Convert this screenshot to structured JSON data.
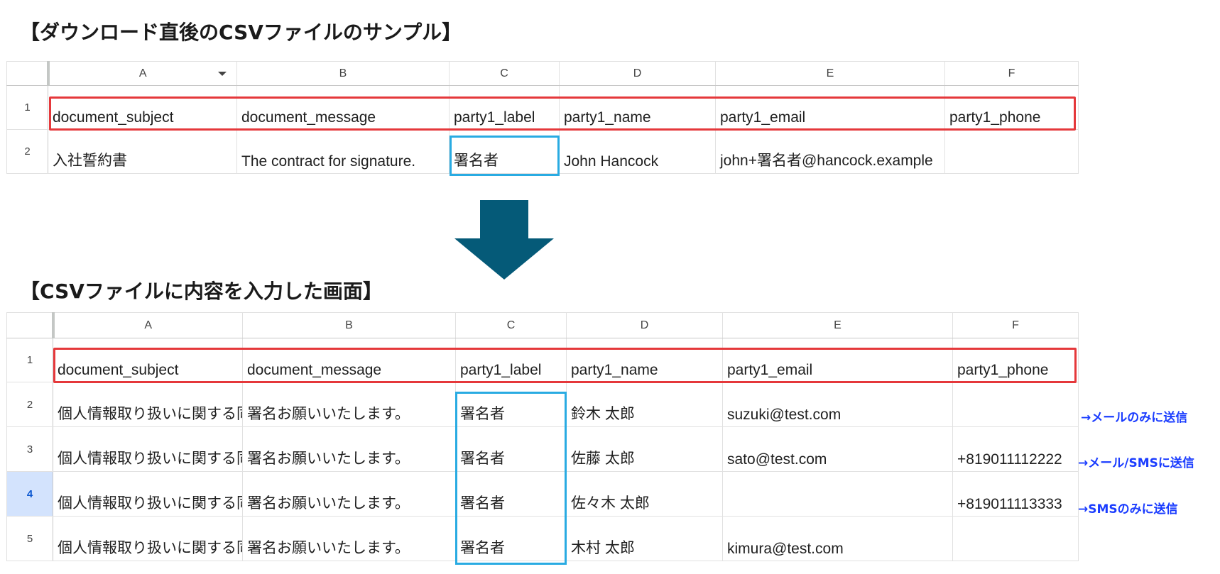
{
  "heading_top": "【ダウンロード直後のCSVファイルのサンプル】",
  "heading_bottom": "【CSVファイルに内容を入力した画面】",
  "columns": [
    "A",
    "B",
    "C",
    "D",
    "E",
    "F"
  ],
  "sheet1": {
    "row_numbers": [
      "1",
      "2"
    ],
    "header": [
      "document_subject",
      "document_message",
      "party1_label",
      "party1_name",
      "party1_email",
      "party1_phone"
    ],
    "rows": [
      [
        "入社誓約書",
        "The contract for signature.",
        "署名者",
        "John Hancock",
        "john+署名者@hancock.example",
        ""
      ]
    ]
  },
  "sheet2": {
    "row_numbers": [
      "1",
      "2",
      "3",
      "4",
      "5"
    ],
    "header": [
      "document_subject",
      "document_message",
      "party1_label",
      "party1_name",
      "party1_email",
      "party1_phone"
    ],
    "rows": [
      [
        "個人情報取り扱いに関する同意書",
        "署名お願いいたします。",
        "署名者",
        "鈴木 太郎",
        "suzuki@test.com",
        ""
      ],
      [
        "個人情報取り扱いに関する同意書",
        "署名お願いいたします。",
        "署名者",
        "佐藤 太郎",
        "sato@test.com",
        "+819011112222"
      ],
      [
        "個人情報取り扱いに関する同意書",
        "署名お願いいたします。",
        "署名者",
        "佐々木 太郎",
        "",
        "+819011113333"
      ],
      [
        "個人情報取り扱いに関する同意書",
        "署名お願いいたします。",
        "署名者",
        "木村 太郎",
        "kimura@test.com",
        ""
      ]
    ],
    "selected_row": "4"
  },
  "notes": {
    "row2": "→メールのみに送信",
    "row3": "→メール/SMSに送信",
    "row4": "→SMSのみに送信"
  },
  "colors": {
    "header_highlight": "#e5383b",
    "label_highlight": "#29abe2",
    "arrow": "#055a78",
    "note_text": "#1a3cff"
  },
  "icons": {
    "filter": "filter-dropdown-icon",
    "arrow": "down-arrow-icon"
  }
}
